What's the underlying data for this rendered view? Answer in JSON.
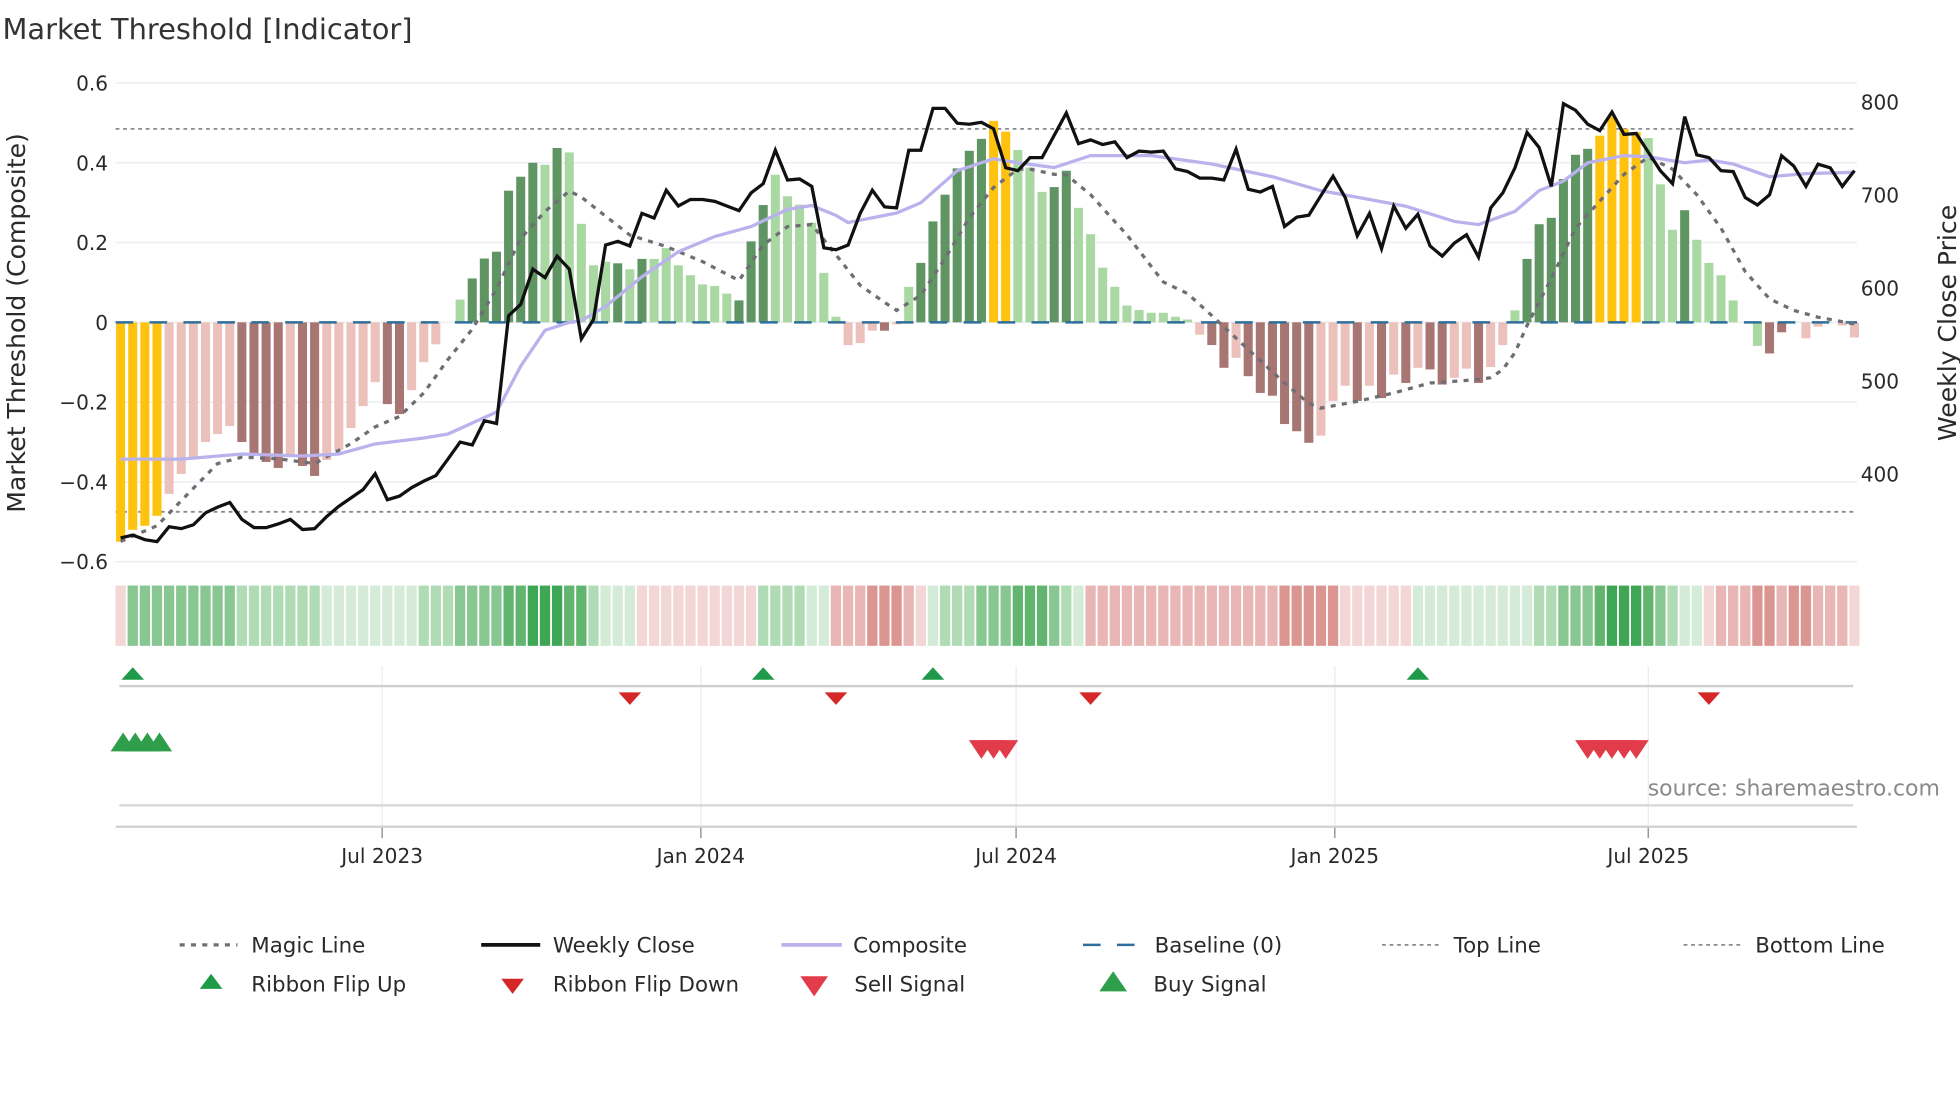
{
  "chart_data": {
    "type": "bar",
    "title": "Market Threshold [Indicator]",
    "ylabel": "Market Threshold (Composite)",
    "y2label": "Weekly Close Price",
    "ylim": [
      -0.6,
      0.6
    ],
    "y2lim": [
      400,
      800
    ],
    "yticks": [
      "0.6",
      "0.4",
      "0.2",
      "0",
      "−0.2",
      "−0.4",
      "−0.6"
    ],
    "ytick_values": [
      0.6,
      0.4,
      0.2,
      0,
      -0.2,
      -0.4,
      -0.6
    ],
    "y2ticks": [
      "800",
      "700",
      "600",
      "500",
      "400"
    ],
    "y2tick_values": [
      800,
      700,
      600,
      500,
      400
    ],
    "xticks": [
      {
        "label": "Jul 2023",
        "date": "2023-07-01"
      },
      {
        "label": "Jan 2024",
        "date": "2024-01-01"
      },
      {
        "label": "Jul 2024",
        "date": "2024-07-01"
      },
      {
        "label": "Jan 2025",
        "date": "2025-01-01"
      },
      {
        "label": "Jul 2025",
        "date": "2025-07-01"
      }
    ],
    "x_start": "2023-01-31",
    "x_step_days": 7,
    "grid": true,
    "top_line": 0.485,
    "bottom_line": -0.475,
    "baseline": 0,
    "bars": {
      "name": "Composite",
      "values": [
        -0.55,
        -0.52,
        -0.51,
        -0.485,
        -0.43,
        -0.38,
        -0.34,
        -0.3,
        -0.28,
        -0.26,
        -0.3,
        -0.335,
        -0.35,
        -0.365,
        -0.33,
        -0.36,
        -0.385,
        -0.345,
        -0.32,
        -0.265,
        -0.21,
        -0.15,
        -0.205,
        -0.23,
        -0.17,
        -0.1,
        -0.055,
        0,
        0.057,
        0.11,
        0.16,
        0.177,
        0.33,
        0.365,
        0.4,
        0.395,
        0.437,
        0.426,
        0.247,
        0.143,
        0.152,
        0.148,
        0.133,
        0.159,
        0.159,
        0.186,
        0.143,
        0.118,
        0.095,
        0.091,
        0.072,
        0.055,
        0.203,
        0.294,
        0.37,
        0.316,
        0.295,
        0.25,
        0.124,
        0.014,
        -0.057,
        -0.052,
        -0.021,
        -0.021,
        -0.005,
        0.089,
        0.149,
        0.253,
        0.32,
        0.386,
        0.43,
        0.46,
        0.505,
        0.478,
        0.432,
        0.388,
        0.327,
        0.339,
        0.38,
        0.287,
        0.221,
        0.137,
        0.089,
        0.042,
        0.031,
        0.024,
        0.024,
        0.014,
        0.007,
        -0.031,
        -0.057,
        -0.114,
        -0.089,
        -0.135,
        -0.177,
        -0.184,
        -0.255,
        -0.273,
        -0.302,
        -0.284,
        -0.197,
        -0.159,
        -0.197,
        -0.159,
        -0.19,
        -0.131,
        -0.152,
        -0.114,
        -0.118,
        -0.156,
        -0.139,
        -0.116,
        -0.152,
        -0.112,
        -0.057,
        0.03,
        0.159,
        0.246,
        0.262,
        0.359,
        0.42,
        0.435,
        0.468,
        0.516,
        0.485,
        0.477,
        0.462,
        0.346,
        0.232,
        0.281,
        0.207,
        0.149,
        0.118,
        0.055,
        0,
        -0.059,
        -0.078,
        -0.025,
        0,
        -0.04,
        -0.011,
        0,
        -0.008,
        -0.038
      ],
      "states": "YYYYrrrrrrRRRRrRRrrrrrRRrrrggGGGGGGgGggggGgGgggggggGGGggggggrrrRrgGGGGGGYYgggGGggggggggggrRRrRRRRRRrrrRrRrRrRRrrRrrgGGGGGGYYYYgggGggggggRRrrrrrrR"
    },
    "state_colors": {
      "Y": "#ffc20e",
      "G": "#5f9463",
      "g": "#a9d8a3",
      "R": "#a87672",
      "r": "#ecc1bc"
    },
    "weekly_close": [
      331,
      334,
      329,
      327,
      343,
      341,
      345,
      358,
      364,
      369,
      351,
      342,
      342,
      346,
      351,
      340,
      341,
      354,
      365,
      374,
      383,
      400,
      372,
      376,
      385,
      392,
      398,
      416,
      434,
      431,
      457,
      454,
      570,
      582,
      620,
      611,
      634,
      620,
      545,
      566,
      646,
      650,
      645,
      680,
      675,
      705,
      688,
      695,
      695,
      693,
      688,
      683,
      702,
      712,
      748,
      716,
      717,
      709,
      643,
      641,
      646,
      680,
      705,
      687,
      686,
      748,
      748,
      793,
      793,
      777,
      776,
      778,
      771,
      729,
      726,
      740,
      740,
      764,
      788,
      755,
      759,
      754,
      757,
      740,
      747,
      746,
      747,
      728,
      725,
      718,
      718,
      716,
      749,
      706,
      703,
      709,
      666,
      676,
      678,
      699,
      720,
      697,
      656,
      680,
      642,
      688,
      664,
      679,
      645,
      634,
      648,
      657,
      633,
      686,
      702,
      729,
      767,
      751,
      709,
      798,
      791,
      776,
      769,
      789,
      765,
      766,
      746,
      726,
      712,
      784,
      743,
      740,
      726,
      725,
      697,
      689,
      700,
      742,
      731,
      709,
      733,
      729,
      709,
      726
    ],
    "composite_line": [
      [
        0,
        -0.343
      ],
      [
        5,
        -0.343
      ],
      [
        10,
        -0.33
      ],
      [
        15,
        -0.335
      ],
      [
        18,
        -0.33
      ],
      [
        21,
        -0.305
      ],
      [
        25,
        -0.29
      ],
      [
        27,
        -0.28
      ],
      [
        31,
        -0.225
      ],
      [
        33,
        -0.11
      ],
      [
        35,
        -0.02
      ],
      [
        37,
        0.0
      ],
      [
        38,
        0.004
      ],
      [
        40,
        0.04
      ],
      [
        43,
        0.114
      ],
      [
        46,
        0.177
      ],
      [
        49,
        0.215
      ],
      [
        52,
        0.24
      ],
      [
        55,
        0.283
      ],
      [
        57,
        0.293
      ],
      [
        59,
        0.268
      ],
      [
        60,
        0.25
      ],
      [
        64,
        0.274
      ],
      [
        66,
        0.3
      ],
      [
        69,
        0.38
      ],
      [
        72,
        0.41
      ],
      [
        74,
        0.4
      ],
      [
        77,
        0.388
      ],
      [
        80,
        0.418
      ],
      [
        85,
        0.418
      ],
      [
        90,
        0.397
      ],
      [
        95,
        0.365
      ],
      [
        99,
        0.33
      ],
      [
        103,
        0.308
      ],
      [
        106,
        0.291
      ],
      [
        110,
        0.253
      ],
      [
        112,
        0.245
      ],
      [
        115,
        0.278
      ],
      [
        117,
        0.33
      ],
      [
        119,
        0.354
      ],
      [
        121,
        0.4
      ],
      [
        124,
        0.418
      ],
      [
        126,
        0.415
      ],
      [
        129,
        0.4
      ],
      [
        131,
        0.407
      ],
      [
        133,
        0.397
      ],
      [
        136,
        0.365
      ],
      [
        139,
        0.373
      ],
      [
        143,
        0.376
      ]
    ],
    "magic_line": [
      [
        0,
        -0.549
      ],
      [
        3,
        -0.51
      ],
      [
        5,
        -0.447
      ],
      [
        8,
        -0.354
      ],
      [
        10,
        -0.338
      ],
      [
        13,
        -0.342
      ],
      [
        16,
        -0.354
      ],
      [
        19,
        -0.304
      ],
      [
        21,
        -0.262
      ],
      [
        23,
        -0.236
      ],
      [
        25,
        -0.177
      ],
      [
        27,
        -0.093
      ],
      [
        29,
        -0.017
      ],
      [
        31,
        0.084
      ],
      [
        33,
        0.21
      ],
      [
        35,
        0.278
      ],
      [
        37,
        0.329
      ],
      [
        38,
        0.314
      ],
      [
        40,
        0.266
      ],
      [
        42,
        0.219
      ],
      [
        45,
        0.19
      ],
      [
        48,
        0.152
      ],
      [
        51,
        0.105
      ],
      [
        53,
        0.194
      ],
      [
        55,
        0.24
      ],
      [
        57,
        0.245
      ],
      [
        59,
        0.169
      ],
      [
        61,
        0.093
      ],
      [
        63,
        0.05
      ],
      [
        64,
        0.03
      ],
      [
        66,
        0.068
      ],
      [
        68,
        0.16
      ],
      [
        70,
        0.262
      ],
      [
        72,
        0.338
      ],
      [
        74,
        0.384
      ],
      [
        75,
        0.384
      ],
      [
        77,
        0.371
      ],
      [
        78,
        0.37
      ],
      [
        80,
        0.32
      ],
      [
        83,
        0.219
      ],
      [
        86,
        0.101
      ],
      [
        88,
        0.072
      ],
      [
        90,
        0.017
      ],
      [
        93,
        -0.068
      ],
      [
        96,
        -0.152
      ],
      [
        98,
        -0.203
      ],
      [
        99,
        -0.215
      ],
      [
        102,
        -0.198
      ],
      [
        105,
        -0.177
      ],
      [
        108,
        -0.152
      ],
      [
        110,
        -0.148
      ],
      [
        112,
        -0.143
      ],
      [
        113,
        -0.139
      ],
      [
        114,
        -0.118
      ],
      [
        115,
        -0.076
      ],
      [
        116,
        -0.008
      ],
      [
        118,
        0.11
      ],
      [
        120,
        0.236
      ],
      [
        122,
        0.304
      ],
      [
        124,
        0.371
      ],
      [
        126,
        0.414
      ],
      [
        128,
        0.384
      ],
      [
        130,
        0.32
      ],
      [
        132,
        0.236
      ],
      [
        134,
        0.127
      ],
      [
        136,
        0.059
      ],
      [
        138,
        0.03
      ],
      [
        140,
        0.013
      ],
      [
        143,
        -0.004
      ]
    ],
    "ribbon": [
      -1,
      3,
      3,
      3,
      3,
      3,
      3,
      3,
      3,
      3,
      2,
      2,
      2,
      2,
      2,
      2,
      2,
      1,
      1,
      1,
      1,
      1,
      1,
      1,
      1,
      2,
      2,
      2,
      3,
      3,
      3,
      3,
      4,
      4,
      5,
      5,
      5,
      4,
      4,
      2,
      1,
      1,
      1,
      -1,
      -1,
      -1,
      -1,
      -1,
      -1,
      -1,
      -1,
      -1,
      -1,
      2,
      2,
      2,
      2,
      1,
      1,
      -2,
      -2,
      -2,
      -3,
      -3,
      -3,
      -2,
      -1,
      1,
      2,
      2,
      2,
      3,
      3,
      3,
      4,
      4,
      4,
      3,
      2,
      1,
      -2,
      -2,
      -2,
      -2,
      -2,
      -2,
      -2,
      -2,
      -2,
      -2,
      -2,
      -2,
      -2,
      -2,
      -2,
      -2,
      -3,
      -3,
      -3,
      -3,
      -3,
      -1,
      -1,
      -1,
      -1,
      -1,
      -1,
      1,
      1,
      1,
      1,
      1,
      1,
      1,
      1,
      1,
      1,
      2,
      2,
      3,
      3,
      3,
      4,
      5,
      5,
      5,
      4,
      3,
      2,
      1,
      1,
      -1,
      -2,
      -2,
      -2,
      -3,
      -3,
      -2,
      -3,
      -3,
      -2,
      -2,
      -2,
      -1
    ],
    "ribbon_flip_up": [
      1,
      53,
      67,
      107
    ],
    "ribbon_flip_down": [
      42,
      59,
      80,
      131
    ],
    "buy_signal": [
      0,
      1,
      2,
      3
    ],
    "sell_signal": [
      71,
      72,
      73,
      121,
      122,
      123,
      124,
      125
    ],
    "colors": {
      "close": "#111111",
      "composite": "#b9b2ec",
      "magic": "#6e6e74",
      "baseline": "#2f6f9a",
      "limit": "#8a8a8a",
      "up": "#1f9a48",
      "down": "#d62728",
      "sell": "#e23c4b",
      "buy": "#2e9e4a"
    },
    "legend": [
      {
        "label": "Magic Line",
        "kind": "magic"
      },
      {
        "label": "Weekly Close",
        "kind": "close"
      },
      {
        "label": "Composite",
        "kind": "composite"
      },
      {
        "label": "Baseline (0)",
        "kind": "baseline"
      },
      {
        "label": "Top Line",
        "kind": "limit"
      },
      {
        "label": "Bottom Line",
        "kind": "limit"
      },
      {
        "label": "Ribbon Flip Up",
        "kind": "up"
      },
      {
        "label": "Ribbon Flip Down",
        "kind": "down"
      },
      {
        "label": "Sell Signal",
        "kind": "sell"
      },
      {
        "label": "Buy Signal",
        "kind": "buy"
      }
    ],
    "source": "source: sharemaestro.com"
  }
}
